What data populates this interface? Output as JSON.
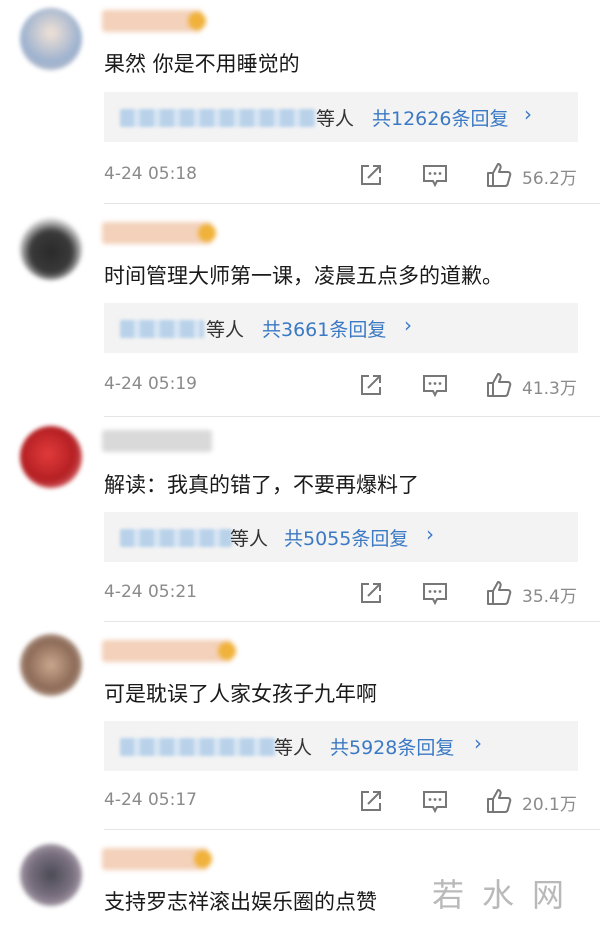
{
  "comments": [
    {
      "text": "果然 你是不用睡觉的",
      "reply_suffix": "等人",
      "reply_count": "共12626条回复",
      "time": "4-24 05:18",
      "likes": "56.2万"
    },
    {
      "text": "时间管理大师第一课，凌晨五点多的道歉。",
      "reply_suffix": "等人",
      "reply_count": "共3661条回复",
      "time": "4-24 05:19",
      "likes": "41.3万"
    },
    {
      "text": "解读：我真的错了，不要再爆料了",
      "reply_suffix": "等人",
      "reply_count": "共5055条回复",
      "time": "4-24 05:21",
      "likes": "35.4万"
    },
    {
      "text": "可是耽误了人家女孩子九年啊",
      "reply_suffix": "等人",
      "reply_count": "共5928条回复",
      "time": "4-24 05:17",
      "likes": "20.1万"
    },
    {
      "text": "支持罗志祥滚出娱乐圈的点赞"
    }
  ],
  "icons": {
    "share": "share-icon",
    "comment": "comment-icon",
    "like": "thumbs-up-icon",
    "reply_arrow": "chevron-right-icon"
  },
  "colors": {
    "link": "#3b79c4",
    "reply_bg": "#f3f3f3",
    "meta_text": "#8a8a8a"
  },
  "watermark": "若水网"
}
